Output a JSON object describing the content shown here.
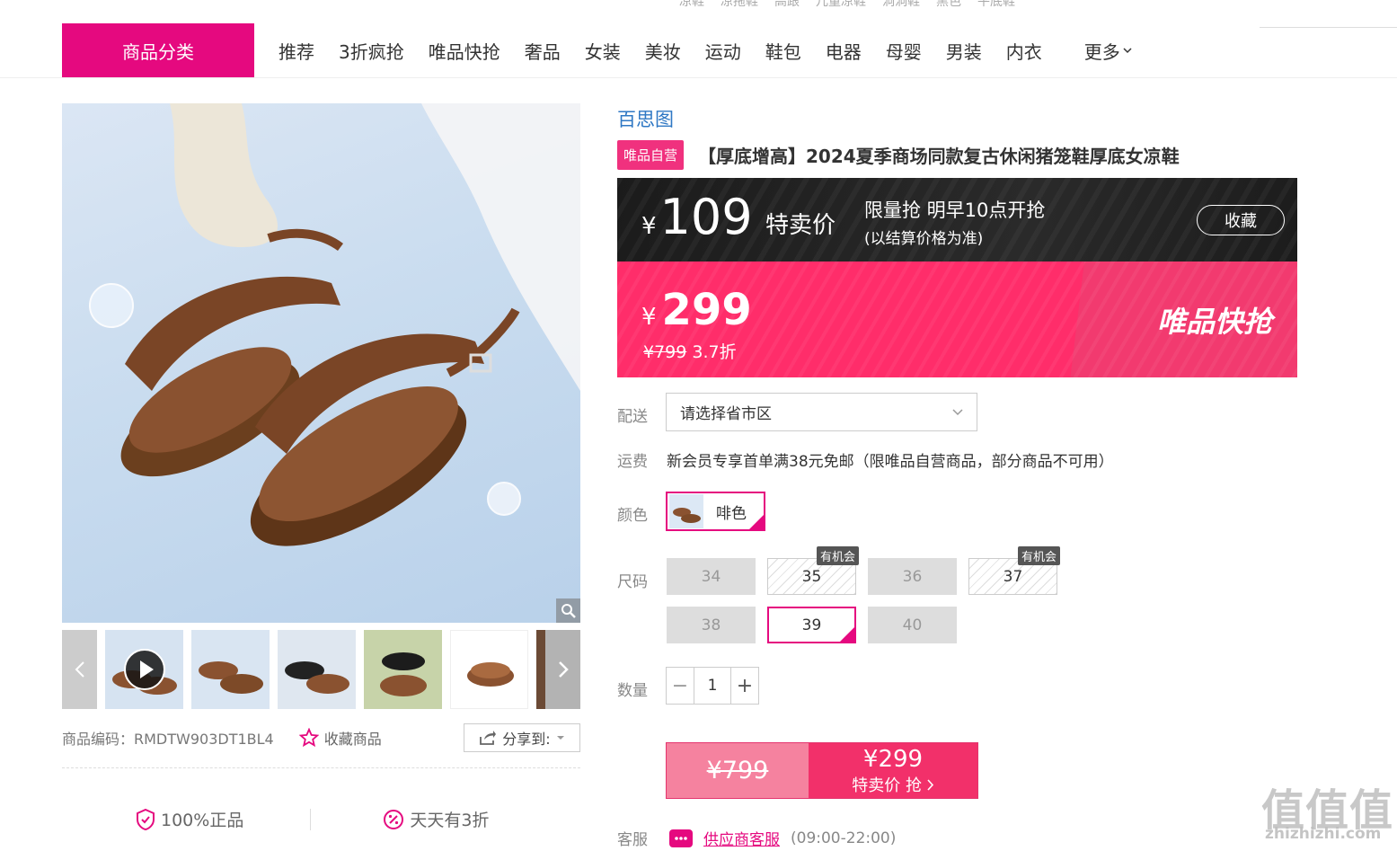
{
  "top_links": [
    "凉鞋",
    "凉拖鞋",
    "高跟",
    "儿童凉鞋",
    "洞洞鞋",
    "黑色",
    "平底鞋"
  ],
  "nav": {
    "category_button": "商品分类",
    "items": [
      "推荐",
      "3折疯抢",
      "唯品快抢",
      "奢品",
      "女装",
      "美妆",
      "运动",
      "鞋包",
      "电器",
      "母婴",
      "男装",
      "内衣"
    ],
    "more": "更多"
  },
  "product": {
    "brand": "百思图",
    "self_tag": "唯品自营",
    "title": "【厚底增高】2024夏季商场同款复古休闲猪笼鞋厚底女凉鞋",
    "code_label": "商品编码：RMDTW903DT1BL4",
    "favorite_label": "收藏商品",
    "share_label": "分享到:"
  },
  "guarantees": [
    "100%正品",
    "天天有3折"
  ],
  "special_price": {
    "yen": "¥",
    "price": "109",
    "label": "特卖价",
    "limit_text": "限量抢 明早10点开抢",
    "note": "(以结算价格为准)",
    "collect": "收藏"
  },
  "flash_price": {
    "yen": "¥",
    "price": "299",
    "original": "¥799",
    "discount": "3.7折",
    "tag": "唯品快抢"
  },
  "delivery": {
    "label": "配送",
    "placeholder": "请选择省市区"
  },
  "freight": {
    "label": "运费",
    "text": "新会员专享首单满38元免邮（限唯品自营商品，部分商品不可用）"
  },
  "color": {
    "label": "颜色",
    "selected": "啡色"
  },
  "size": {
    "label": "尺码",
    "options": [
      "34",
      "35",
      "36",
      "37",
      "38",
      "39",
      "40"
    ],
    "chance_tag": "有机会"
  },
  "quantity": {
    "label": "数量",
    "value": "1",
    "minus": "−",
    "plus": "+"
  },
  "buy": {
    "old_price": "¥799",
    "price": "¥299",
    "label": "特卖价 抢"
  },
  "service": {
    "label": "客服",
    "link": "供应商客服",
    "hours": "(09:00-22:00)"
  },
  "watermark": {
    "main": "值值值",
    "sub": "zhizhizhi.com"
  },
  "colors": {
    "accent": "#e5097f",
    "flash_bg": "#ff2d6a",
    "dark_bg": "#1b1b1b",
    "brand_link": "#2f78c4"
  },
  "icons": [
    "play-icon",
    "zoom-icon",
    "star-icon",
    "share-icon",
    "shield-icon",
    "discount-icon",
    "chevron-down-icon",
    "chat-icon"
  ]
}
